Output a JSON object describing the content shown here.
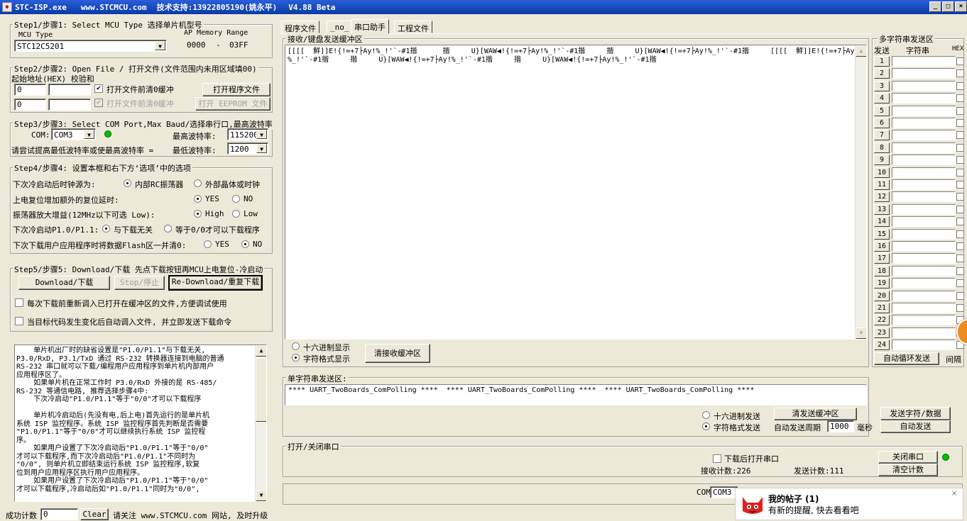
{
  "titlebar": {
    "app": "STC-ISP.exe",
    "site": "www.STCMCU.com",
    "support": "技术支持:13922805190(姚永平)",
    "version": "V4.88 Beta",
    "buttons": [
      "_",
      "□",
      "×"
    ]
  },
  "step1": {
    "title": "Step1/步骤1: Select MCU Type  选择单片机型号",
    "mcu_type_label": "MCU Type",
    "ap_label": "AP Memory Range",
    "mcu_value": "STC12C5201",
    "range_from": "0000",
    "range_sep": "-",
    "range_to": "03FF"
  },
  "step2": {
    "title": "Step2/步骤2: Open File / 打开文件(文件范围内未用区域填00)",
    "addr_label": "起始地址(HEX) 校验和",
    "addr1": "0",
    "chk1": "",
    "addr2": "0",
    "chk2": "",
    "clear_before_open": "打开文件前清0缓冲",
    "clear_before_open2": "打开文件前清0缓冲",
    "open_prog_button": "打开程序文件",
    "open_eeprom_button": "打开 EEPROM 文件"
  },
  "step3": {
    "title": "Step3/步骤3: Select COM Port,Max Baud/选择串行口,最高波特率",
    "com_label": "COM:",
    "com_value": "COM3",
    "max_baud_label": "最高波特率:",
    "max_baud_value": "115200",
    "hint": "请尝试提高最低波特率或使最高波特率 =",
    "min_baud_label": "最低波特率:",
    "min_baud_value": "1200"
  },
  "step4": {
    "title": "Step4/步骤4: 设置本框和右下方‘选项’中的选项",
    "r1": {
      "label": "下次冷启动后时钟源为:",
      "a": "内部RC振荡器",
      "b": "外部晶体或时钟"
    },
    "r2": {
      "label": "上电复位增加额外的复位延时:",
      "a": "YES",
      "b": "NO"
    },
    "r3": {
      "label": "振荡器放大增益(12MHz以下可选 Low):",
      "a": "High",
      "b": "Low"
    },
    "r4": {
      "label": "下次冷启动P1.0/P1.1:",
      "a": "与下载无关",
      "b": "等于0/0才可以下载程序"
    },
    "r5": {
      "label": "下次下载用户应用程序时将数据Flash区一并清0:",
      "a": "YES",
      "b": "NO"
    }
  },
  "step5": {
    "title": "Step5/步骤5: Download/下载  先点下载按钮再MCU上电复位-冷启动",
    "download_button": "Download/下载",
    "stop_button": "Stop/停止",
    "redownload_button": "Re-Download/重复下载",
    "opt1": "每次下载前重新调入已打开在缓冲区的文件,方便调试使用",
    "opt2": "当目标代码发生变化后自动调入文件, 并立即发送下载命令"
  },
  "info_text": [
    "    单片机出厂时的缺省设置是\"P1.0/P1.1\"与下载无关,",
    "P3.0/RxD, P3.1/TxD 通过 RS-232 转换器连接到电脑的普通",
    "RS-232 串口就可以下载/编程用户应用程序到单片机内部用户",
    "应用程序区了。",
    "    如果单片机在正常工作时 P3.0/RxD 外接的是 RS-485/",
    "RS-232 等通信电路, 推荐选择步骤4中:",
    "    下次冷启动\"P1.0/P1.1\"等于\"0/0\"才可以下载程序",
    "",
    "    单片机冷启动后(先没有电,后上电)首先运行的是单片机",
    "系统 ISP 监控程序。系统 ISP 监控程序首先判断是否需要",
    "\"P1.0/P1.1\"等于\"0/0\"才可以继续执行系统 ISP 监控程",
    "序。",
    "    如果用户设置了下次冷启动后\"P1.0/P1.1\"等于\"0/0\"",
    "才可以下载程序,而下次冷启动后\"P1.0/P1.1\"不同时为",
    "\"0/0\", 则单片机立即结束运行系统 ISP 监控程序,软复",
    "位到用户应用程序区执行用户应用程序。",
    "    如果用户设置了下次冷启动后\"P1.0/P1.1\"等于\"0/0\"",
    "才可以下载程序,冷启动后如\"P1.0/P1.1\"同时为\"0/0\","
  ],
  "statusbar": {
    "success_label": "成功计数",
    "success_value": "0",
    "clear_button": "Clear",
    "follow": "请关注 www.STCMCU.com 网站, 及时升级"
  },
  "tabs": [
    "程序文件",
    "_no_",
    "串口助手",
    "工程文件"
  ],
  "recv": {
    "title": "接收/键盘发送缓冲区",
    "line1": "[[[[  鮮]]E!{!=+7├Ay!%_!'`-#1揩      揩     U}[WAW◀!{!=+7├Ay!%_!'`-#1揩     揩     U}[WAW◀!{!=+7├Ay!%_!'`-#1揩     [[[[  鮮]]E!{!=+7├Ay!",
    "line2": "%_!'`-#1揩     揩     U}[WAW◀!{!=+7├Ay!%_!'`-#1揩     揩     U}[WAW◀!{!=+7├Ay!%_!'`-#1揩",
    "hex_label": "十六进制显示",
    "char_label": "字符格式显示",
    "clear_button": "清接收缓冲区"
  },
  "single_send": {
    "title": "单字符串发送区:",
    "content": "**** UART_TwoBoards_ComPolling ****  **** UART_TwoBoards_ComPolling ****  **** UART_TwoBoards_ComPolling ****",
    "hex_label": "十六进制发送",
    "char_label": "字符格式发送",
    "clear_button": "清发送缓冲区",
    "send_button": "发送字符/数据",
    "period_label": "自动发送周期",
    "period_value": "1000",
    "ms_label": "毫秒",
    "auto_button": "自动发送"
  },
  "port": {
    "title": "打开/关闭串口",
    "open_after_download": "下载后打开串口",
    "close_button": "关闭串口",
    "recv_count": "接收计数:226",
    "send_count": "发送计数:111",
    "clear_count_button": "清空计数",
    "com_label": "COM",
    "com_value": "COM3"
  },
  "multi": {
    "title": "多字符串发送区",
    "send_hdr": "发送",
    "str_hdr": "字符串",
    "hex_hdr": "HEX",
    "rows": [
      "1",
      "2",
      "3",
      "4",
      "5",
      "6",
      "7",
      "8",
      "9",
      "10",
      "11",
      "12",
      "13",
      "14",
      "15",
      "16",
      "17",
      "18",
      "19",
      "20",
      "21",
      "22",
      "23",
      "24"
    ],
    "loop_button": "自动循环发送",
    "interval": "间隔"
  },
  "notice": {
    "title": "我的帖子 (1)",
    "text": "有新的提醒, 快去看看吧",
    "close": "×"
  },
  "colors": {
    "title_bar": "#0a3aa8",
    "face": "#ece9d8",
    "led": "#00c000"
  }
}
